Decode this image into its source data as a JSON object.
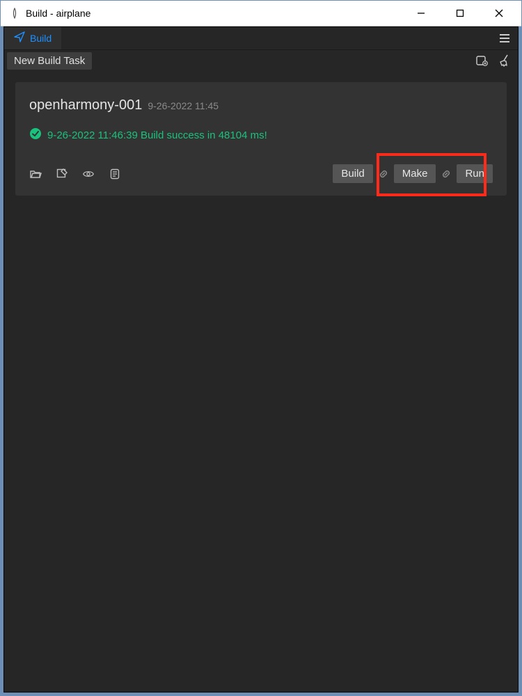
{
  "window": {
    "title": "Build - airplane"
  },
  "tab": {
    "label": "Build"
  },
  "toolbar": {
    "new_task_label": "New Build Task"
  },
  "card": {
    "title": "openharmony-001",
    "timestamp": "9-26-2022 11:45",
    "status_text": "9-26-2022 11:46:39 Build success in 48104 ms!"
  },
  "actions": {
    "build_label": "Build",
    "make_label": "Make",
    "run_label": "Run"
  },
  "colors": {
    "accent": "#1e90ff",
    "success": "#19c37d",
    "highlight": "#ff2a1a"
  }
}
